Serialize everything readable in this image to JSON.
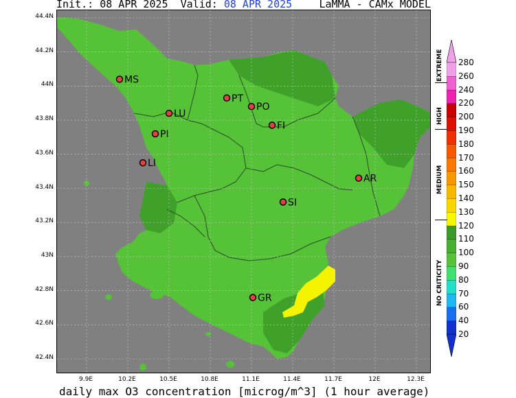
{
  "header": {
    "init": "Init.: 08 APR 2025",
    "valid_label": "Valid:",
    "valid_date": "08 APR 2025",
    "model": "LaMMA - CAMx MODEL"
  },
  "footer": {
    "title": "daily max O3 concentration [microg/m^3] (1 hour average)"
  },
  "colors": {
    "sea": "#808080",
    "land_base": "#55c238",
    "land_dark": "#3fa02a",
    "hotspot": "#f4f400",
    "borders": "#2a4a2a",
    "city_fill": "#e84040"
  },
  "axes": {
    "latitude_ticks": [
      "44.4N",
      "44.2N",
      "44N",
      "43.8N",
      "43.6N",
      "43.4N",
      "43.2N",
      "43N",
      "42.8N",
      "42.6N",
      "42.4N"
    ],
    "longitude_ticks": [
      "9.9E",
      "10.2E",
      "10.5E",
      "10.8E",
      "11.1E",
      "11.4E",
      "11.7E",
      "12E",
      "12.3E"
    ]
  },
  "cities": [
    {
      "code": "MS",
      "lon": 10.14,
      "lat": 44.04
    },
    {
      "code": "LU",
      "lon": 10.5,
      "lat": 43.84
    },
    {
      "code": "PI",
      "lon": 10.4,
      "lat": 43.72
    },
    {
      "code": "LI",
      "lon": 10.31,
      "lat": 43.55
    },
    {
      "code": "PT",
      "lon": 10.92,
      "lat": 43.93
    },
    {
      "code": "PO",
      "lon": 11.1,
      "lat": 43.88
    },
    {
      "code": "FI",
      "lon": 11.25,
      "lat": 43.77
    },
    {
      "code": "AR",
      "lon": 11.88,
      "lat": 43.46
    },
    {
      "code": "SI",
      "lon": 11.33,
      "lat": 43.32
    },
    {
      "code": "GR",
      "lon": 11.11,
      "lat": 42.76
    }
  ],
  "colorbar": {
    "levels": [
      "20",
      "40",
      "60",
      "70",
      "80",
      "90",
      "100",
      "110",
      "120",
      "130",
      "140",
      "150",
      "160",
      "170",
      "180",
      "190",
      "200",
      "220",
      "240",
      "260",
      "280"
    ],
    "colors": [
      "#1030d0",
      "#1870f0",
      "#20b8f0",
      "#20e0c8",
      "#40e070",
      "#55c238",
      "#48b030",
      "#3c9a28",
      "#f8f800",
      "#f8d800",
      "#f8b800",
      "#f89800",
      "#f87800",
      "#f85800",
      "#f03000",
      "#e01000",
      "#c80000",
      "#f020b0",
      "#f060d0",
      "#f0a0e8"
    ],
    "categories": [
      {
        "label": "NO CRITICITY"
      },
      {
        "label": "MEDIUM"
      },
      {
        "label": "HIGH"
      },
      {
        "label": "EXTREME"
      }
    ]
  }
}
